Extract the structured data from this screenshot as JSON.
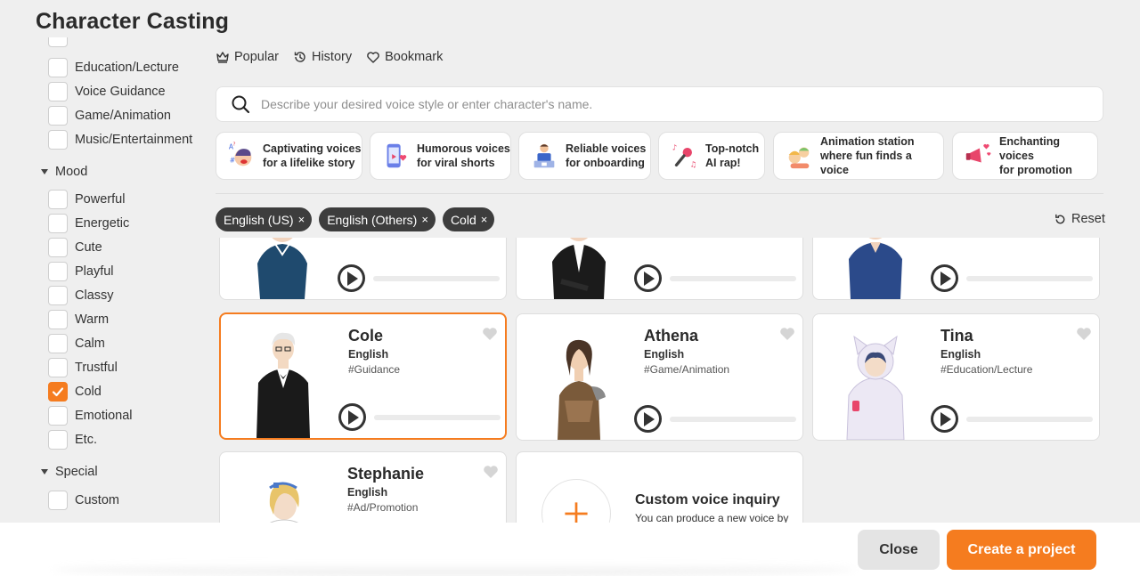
{
  "page_title": "Character Casting",
  "sidebar": {
    "categories": [
      {
        "label": "Education/Lecture",
        "checked": false
      },
      {
        "label": "Voice Guidance",
        "checked": false
      },
      {
        "label": "Game/Animation",
        "checked": false
      },
      {
        "label": "Music/Entertainment",
        "checked": false
      }
    ],
    "mood_heading": "Mood",
    "moods": [
      {
        "label": "Powerful",
        "checked": false
      },
      {
        "label": "Energetic",
        "checked": false
      },
      {
        "label": "Cute",
        "checked": false
      },
      {
        "label": "Playful",
        "checked": false
      },
      {
        "label": "Classy",
        "checked": false
      },
      {
        "label": "Warm",
        "checked": false
      },
      {
        "label": "Calm",
        "checked": false
      },
      {
        "label": "Trustful",
        "checked": false
      },
      {
        "label": "Cold",
        "checked": true
      },
      {
        "label": "Emotional",
        "checked": false
      },
      {
        "label": "Etc.",
        "checked": false
      }
    ],
    "special_heading": "Special",
    "special": [
      {
        "label": "Custom",
        "checked": false
      }
    ]
  },
  "topnav": {
    "popular": "Popular",
    "history": "History",
    "bookmark": "Bookmark"
  },
  "search": {
    "placeholder": "Describe your desired voice style or enter character's name."
  },
  "suggestions": [
    {
      "text": "Captivating voices\nfor a lifelike story",
      "icon": "speaking-face-icon"
    },
    {
      "text": "Humorous voices\nfor viral shorts",
      "icon": "phone-heart-icon"
    },
    {
      "text": "Reliable voices\nfor onboarding",
      "icon": "presenter-icon"
    },
    {
      "text": "Top-notch\nAI rap!",
      "icon": "microphone-icon"
    },
    {
      "text": "Animation station\nwhere fun finds a voice",
      "icon": "kids-icon"
    },
    {
      "text": "Enchanting voices\nfor promotion",
      "icon": "megaphone-icon"
    }
  ],
  "filters": {
    "chips": [
      "English (US)",
      "English (Others)",
      "Cold"
    ],
    "remove_symbol": "×",
    "reset_label": "Reset"
  },
  "voices": [
    {
      "name": "",
      "language": "",
      "tag": ""
    },
    {
      "name": "",
      "language": "",
      "tag": ""
    },
    {
      "name": "",
      "language": "",
      "tag": ""
    },
    {
      "name": "Cole",
      "language": "English",
      "tag": "#Guidance",
      "selected": true
    },
    {
      "name": "Athena",
      "language": "English",
      "tag": "#Game/Animation"
    },
    {
      "name": "Tina",
      "language": "English",
      "tag": "#Education/Lecture"
    },
    {
      "name": "Stephanie",
      "language": "English",
      "tag": "#Ad/Promotion"
    }
  ],
  "custom_inquiry": {
    "title": "Custom voice inquiry",
    "subtitle": "You can produce a new voice by"
  },
  "footer": {
    "close_label": "Close",
    "create_label": "Create a project"
  },
  "colors": {
    "accent": "#f57c1f",
    "chip_bg": "#3d3d3d",
    "background": "#efefef"
  }
}
